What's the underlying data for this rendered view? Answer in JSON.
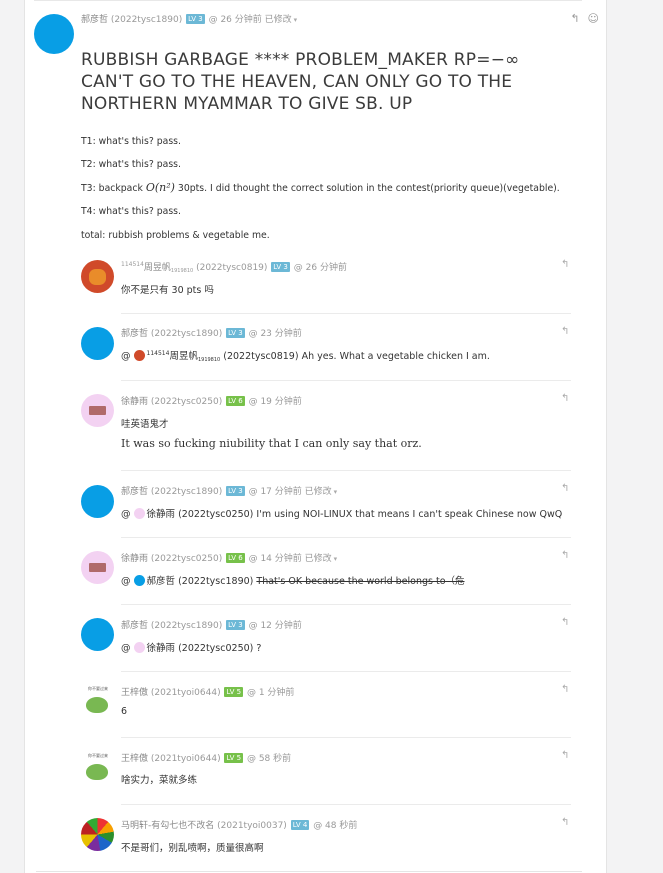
{
  "post": {
    "author": "郝彦哲",
    "handle": "(2022tysc1890)",
    "level": "LV 3",
    "time": "@ 26 分钟前",
    "edited": "已修改",
    "title": "RUBBISH GARBAGE **** PROBLEM_MAKER RP=−∞ CAN'T GO TO THE HEAVEN, CAN ONLY GO TO THE NORTHERN MYAMMAR TO GIVE SB. UP",
    "lines": [
      "T1: what's this? pass.",
      "T2: what's this? pass.",
      "T3: backpack",
      "30pts. I did thought the correct solution in the contest(priority queue)(vegetable).",
      "T4: what's this? pass.",
      "total: rubbish problems & vegetable me."
    ],
    "math": "O(n²)"
  },
  "replies": [
    {
      "sup": "114514",
      "author": "周昱帆",
      "sub": "1919810",
      "handle": "(2022tysc0819)",
      "level": "LV 3",
      "time": "@ 26 分钟前",
      "text": "你不是只有 30 pts 吗"
    },
    {
      "author": "郝彦哲",
      "handle": "(2022tysc1890)",
      "level": "LV 3",
      "time": "@ 23 分钟前",
      "at": "@",
      "mention_sup": "114514",
      "mention": "周昱帆",
      "mention_sub": "1919810",
      "mention_handle": "(2022tysc0819)",
      "text": "Ah yes. What a vegetable chicken I am."
    },
    {
      "author": "徐静雨",
      "handle": "(2022tysc0250)",
      "level": "LV 6",
      "time": "@ 19 分钟前",
      "text": "哇英语鬼才",
      "text2": "It was so fucking niubility that I can only say that orz."
    },
    {
      "author": "郝彦哲",
      "handle": "(2022tysc1890)",
      "level": "LV 3",
      "time": "@ 17 分钟前",
      "edited": "已修改",
      "at": "@",
      "mention": "徐静雨",
      "mention_handle": "(2022tysc0250)",
      "text": "I'm using NOI-LINUX that means I can't speak Chinese now QwQ"
    },
    {
      "author": "徐静雨",
      "handle": "(2022tysc0250)",
      "level": "LV 6",
      "time": "@ 14 分钟前",
      "edited": "已修改",
      "at": "@",
      "mention": "郝彦哲",
      "mention_handle": "(2022tysc1890)",
      "text": "That's OK because the world belongs to（危"
    },
    {
      "author": "郝彦哲",
      "handle": "(2022tysc1890)",
      "level": "LV 3",
      "time": "@ 12 分钟前",
      "at": "@",
      "mention": "徐静雨",
      "mention_handle": "(2022tysc0250)",
      "text": "?"
    },
    {
      "author": "王梓傲",
      "handle": "(2021tyoi0644)",
      "level": "LV 5",
      "time": "@ 1 分钟前",
      "text": "6",
      "avatar_caption": "你不要过来"
    },
    {
      "author": "王梓傲",
      "handle": "(2021tyoi0644)",
      "level": "LV 5",
      "time": "@ 58 秒前",
      "text": "啥实力，菜就多练",
      "avatar_caption": "你不要过来"
    },
    {
      "author": "马明轩-有勾七也不改名",
      "handle": "(2021tyoi0037)",
      "level": "LV 4",
      "time": "@ 48 秒前",
      "text": "不是哥们，别乱喷啊，质量很高啊"
    }
  ],
  "icons": {
    "reply": "reply-icon",
    "emoji": "emoji-icon",
    "caret": "chevron-down-icon"
  },
  "colors": {
    "avatar_blue": "#089ee5",
    "level_blue": "#6cb8d6",
    "level_green": "#77c14a"
  }
}
